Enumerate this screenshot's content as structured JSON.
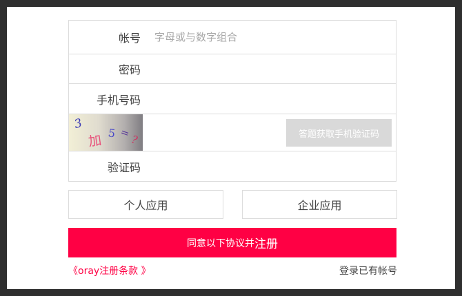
{
  "form": {
    "account_label": "帐号",
    "account_placeholder": "字母或与数字组合",
    "password_label": "密码",
    "phone_label": "手机号码",
    "captcha_chars": [
      "3",
      "加",
      "5",
      "=",
      "?"
    ],
    "sms_button": "答题获取手机验证码",
    "code_label": "验证码"
  },
  "choices": {
    "personal": "个人应用",
    "enterprise": "企业应用"
  },
  "submit": {
    "prefix": "同意以下协议并",
    "emphasis": "注册"
  },
  "footer": {
    "terms_link": "《oray注册条款 》",
    "login_link": "登录已有帐号"
  },
  "colors": {
    "accent": "#ff0044",
    "disabled_button": "#d9d9d9",
    "border": "#dcdcdc",
    "background_frame": "#2f2f2f"
  }
}
